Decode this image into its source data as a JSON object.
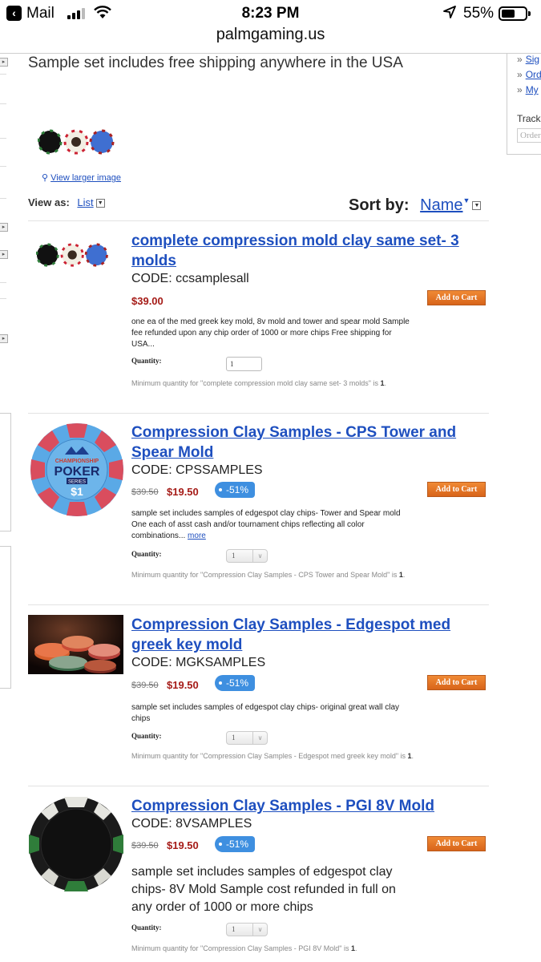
{
  "status_bar": {
    "back_app": "Mail",
    "time": "8:23 PM",
    "battery": "55%"
  },
  "browser": {
    "url": "palmgaming.us"
  },
  "sidebar_right": {
    "links": [
      "Sig",
      "Ord",
      "My"
    ],
    "track_label": "Track",
    "order_placeholder": "Order"
  },
  "category": {
    "description": "Sample set includes free shipping anywhere in the USA",
    "view_larger": "View larger image"
  },
  "listing_controls": {
    "view_as_label": "View as:",
    "view_as_value": "List",
    "sort_by_label": "Sort by:",
    "sort_by_value": "Name"
  },
  "products": [
    {
      "title": "complete compression mold clay same set- 3 molds",
      "code": "CODE: ccsamplesall",
      "price": "$39.00",
      "add_to_cart": "Add to Cart",
      "summary": "one ea of the med greek key mold, 8v mold and tower and spear mold Sample fee refunded upon any chip order of 1000 or more chips Free shipping for USA...",
      "quantity_label": "Quantity:",
      "quantity_value": "1",
      "min_qty_text": "Minimum quantity for \"complete compression mold clay same set- 3 molds\" is ",
      "min_qty_value": "1",
      "min_qty_end": "."
    },
    {
      "title": "Compression Clay Samples - CPS Tower and Spear Mold",
      "code": "CODE: CPSSAMPLES",
      "old_price": "$39.50",
      "price": "$19.50",
      "discount": "-51%",
      "add_to_cart": "Add to Cart",
      "summary": "sample set includes samples of edgespot clay chips- Tower and Spear mold One each of asst cash and/or tournament chips reflecting all color combinations...",
      "more": "more",
      "quantity_label": "Quantity:",
      "quantity_value": "1",
      "min_qty_text": "Minimum quantity for \"Compression Clay Samples - CPS Tower and Spear Mold\" is ",
      "min_qty_value": "1",
      "min_qty_end": ".",
      "chip_text": {
        "top": "CHAMPIONSHIP",
        "main": "POKER",
        "sub": "SERIES",
        "value": "$1"
      }
    },
    {
      "title": "Compression Clay Samples - Edgespot med greek key mold",
      "code": "CODE: MGKSAMPLES",
      "old_price": "$39.50",
      "price": "$19.50",
      "discount": "-51%",
      "add_to_cart": "Add to Cart",
      "summary": "sample set includes samples of edgespot clay chips- original great wall clay chips",
      "quantity_label": "Quantity:",
      "quantity_value": "1",
      "min_qty_text": "Minimum quantity for \"Compression Clay Samples - Edgespot med greek key mold\" is ",
      "min_qty_value": "1",
      "min_qty_end": "."
    },
    {
      "title": "Compression Clay Samples - PGI 8V Mold",
      "code": "CODE: 8VSAMPLES",
      "old_price": "$39.50",
      "price": "$19.50",
      "discount": "-51%",
      "add_to_cart": "Add to Cart",
      "summary": "sample set includes samples of edgespot clay chips- 8V Mold Sample cost refunded in full on any order of 1000 or more chips",
      "quantity_label": "Quantity:",
      "quantity_value": "1",
      "min_qty_text": "Minimum quantity for \"Compression Clay Samples - PGI 8V Mold\" is ",
      "min_qty_value": "1",
      "min_qty_end": "."
    }
  ],
  "colors": {
    "link": "#1e4fbf",
    "price": "#a51b17",
    "cart": "#e0702a",
    "badge": "#3e8fe0"
  }
}
